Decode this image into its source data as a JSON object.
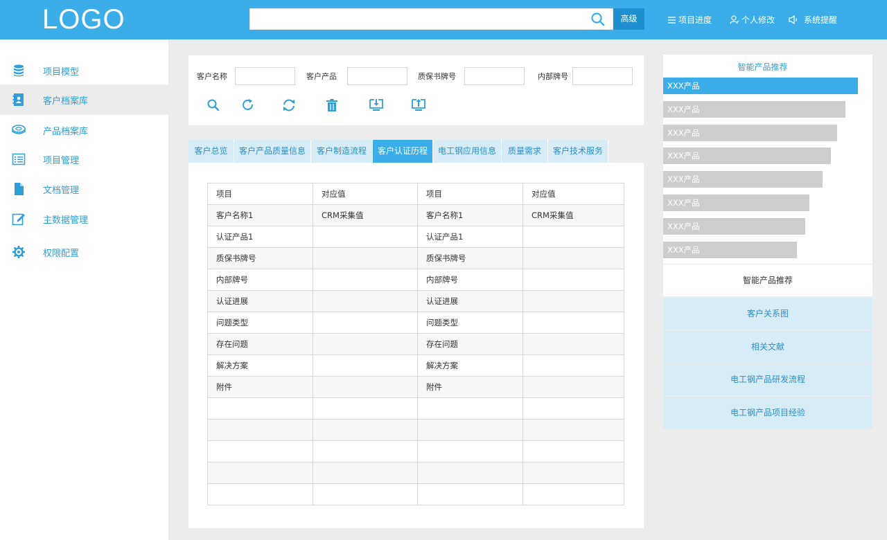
{
  "header": {
    "logo": "LOGO",
    "search": {
      "placeholder": ""
    },
    "advanced_label": "高级",
    "nav": [
      "项目进度",
      "个人修改",
      "系统提醒"
    ]
  },
  "sidebar": {
    "items": [
      {
        "label": "项目模型",
        "icon": "database-icon"
      },
      {
        "label": "客户档案库",
        "icon": "contact-book-icon",
        "active": true
      },
      {
        "label": "产品档案库",
        "icon": "coil-icon"
      },
      {
        "label": "项目管理",
        "icon": "list-icon"
      },
      {
        "label": "文档管理",
        "icon": "document-icon"
      },
      {
        "label": "主数据管理",
        "icon": "edit-icon"
      },
      {
        "label": "权限配置",
        "icon": "gear-icon"
      }
    ]
  },
  "filters": {
    "fields": [
      {
        "label": "客户名称",
        "value": ""
      },
      {
        "label": "客户产品",
        "value": ""
      },
      {
        "label": "质保书牌号",
        "value": ""
      },
      {
        "label": "内部牌号",
        "value": ""
      }
    ],
    "tools": [
      "search-icon",
      "refresh-icon",
      "sync-icon",
      "trash-icon",
      "download-icon",
      "upload-icon"
    ]
  },
  "tabs": [
    {
      "label": "客户总览"
    },
    {
      "label": "客户产品质量信息"
    },
    {
      "label": "客户制造流程"
    },
    {
      "label": "客户认证历程",
      "active": true
    },
    {
      "label": "电工钢应用信息"
    },
    {
      "label": "质量需求"
    },
    {
      "label": "客户技术服务"
    }
  ],
  "table": {
    "header": [
      "项目",
      "对应值",
      "项目",
      "对应值"
    ],
    "rows": [
      [
        "客户名称1",
        "CRM采集值",
        "客户名称1",
        "CRM采集值"
      ],
      [
        "认证产品1",
        "",
        "认证产品1",
        ""
      ],
      [
        "质保书牌号",
        "",
        "质保书牌号",
        ""
      ],
      [
        "内部牌号",
        "",
        "内部牌号",
        ""
      ],
      [
        "认证进展",
        "",
        "认证进展",
        ""
      ],
      [
        "问题类型",
        "",
        "问题类型",
        ""
      ],
      [
        "存在问题",
        "",
        "存在问题",
        ""
      ],
      [
        "解决方案",
        "",
        "解决方案",
        ""
      ],
      [
        "附件",
        "",
        "附件",
        ""
      ],
      [
        "",
        "",
        "",
        ""
      ],
      [
        "",
        "",
        "",
        ""
      ],
      [
        "",
        "",
        "",
        ""
      ],
      [
        "",
        "",
        "",
        ""
      ],
      [
        "",
        "",
        "",
        ""
      ]
    ]
  },
  "recommend": {
    "title": "智能产品推荐",
    "bars": [
      {
        "label": "XXX产品",
        "active": true,
        "level": 0.93
      },
      {
        "label": "XXX产品",
        "level": 0.87
      },
      {
        "label": "XXX产品",
        "level": 0.83
      },
      {
        "label": "XXX产品",
        "level": 0.8
      },
      {
        "label": "XXX产品",
        "level": 0.76
      },
      {
        "label": "XXX产品",
        "level": 0.7
      },
      {
        "label": "XXX产品",
        "level": 0.68
      },
      {
        "label": "XXX产品",
        "level": 0.64
      }
    ]
  },
  "right_menu": [
    "智能产品推荐",
    "客户关系图",
    "相关文献",
    "电工钢产品研发流程",
    "电工钢产品项目经验"
  ],
  "colors": {
    "accent": "#3baeea",
    "accent_dark": "#1e90cf",
    "tab_bg": "#d8ecf7",
    "bar_gray": "#cdcdcd"
  }
}
